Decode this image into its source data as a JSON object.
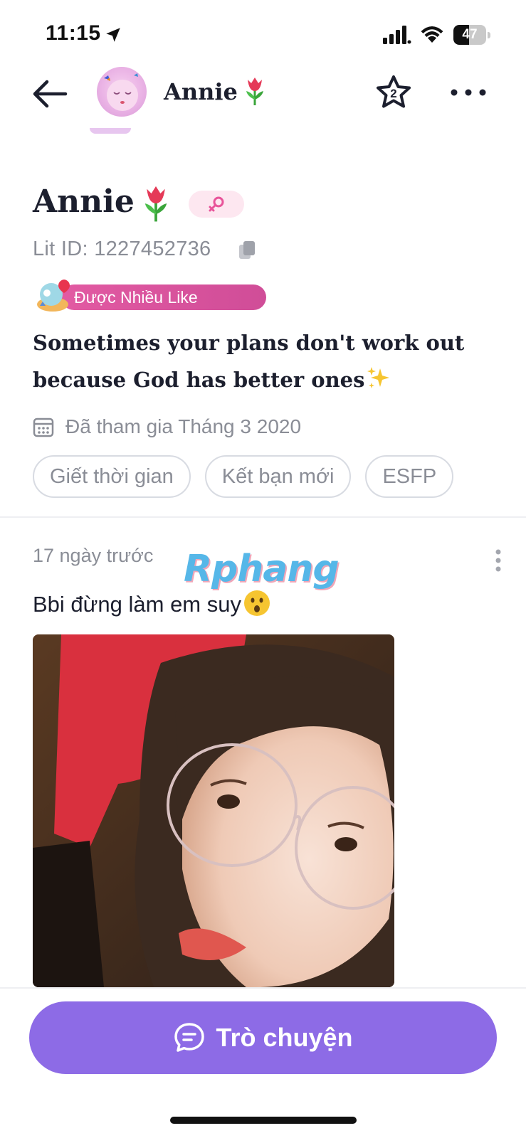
{
  "status_bar": {
    "time": "11:15",
    "battery": "47",
    "battery_level": 0.47,
    "icons": [
      "location-arrow-icon",
      "signal-icon",
      "wifi-icon",
      "battery-icon"
    ]
  },
  "header": {
    "name": "Annie",
    "icons": [
      "back-arrow-icon",
      "tulip-emoji-icon",
      "star-badge-icon",
      "more-dots-icon"
    ],
    "star_badge_count": "2"
  },
  "profile": {
    "name": "Annie",
    "lit_id": "Lit ID: 1227452736",
    "badge": "Được Nhiều Like",
    "bio": "Sometimes your plans don't work out because God has better ones",
    "joined": "Đã tham gia Tháng 3 2020",
    "tags": [
      "Giết thời gian",
      "Kết bạn mới",
      "ESFP"
    ],
    "gender": "female"
  },
  "post": {
    "time": "17 ngày trước",
    "text": "Bbi đừng làm em suy",
    "watermark": "Rphang"
  },
  "chat_button": {
    "label": "Trò chuyện"
  },
  "colors": {
    "accent": "#8d6be6",
    "badge_pink": "#d04d98",
    "text_primary": "#1c1f2e",
    "text_secondary": "#8a8d96"
  }
}
